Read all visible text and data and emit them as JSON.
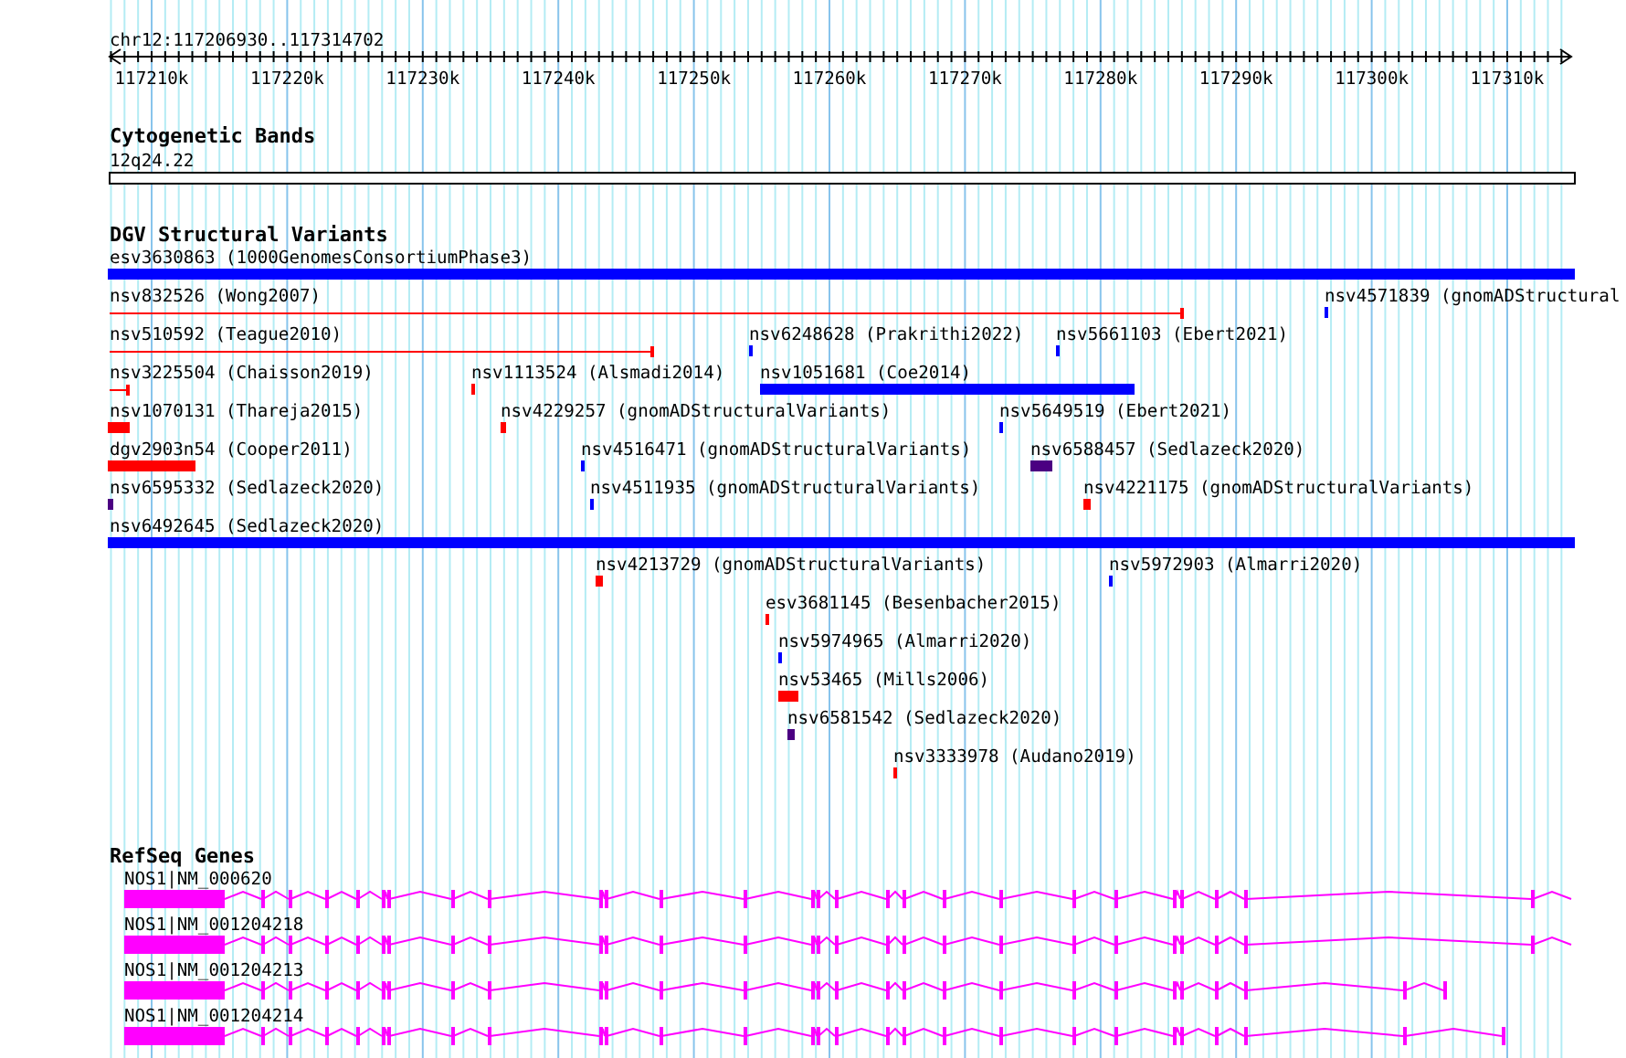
{
  "ruler": {
    "location": "chr12:117206930..117314702",
    "ticks": [
      "117210k",
      "117220k",
      "117230k",
      "117240k",
      "117250k",
      "117260k",
      "117270k",
      "117280k",
      "117290k",
      "117300k",
      "117310k"
    ]
  },
  "cytobands": {
    "title": "Cytogenetic Bands",
    "band": "12q24.22"
  },
  "variants": {
    "title": "DGV Structural Variants",
    "features": [
      {
        "label": "esv3630863 (1000GenomesConsortiumPhase3)",
        "color": "#0000ff",
        "kind": "block"
      },
      {
        "label": "nsv832526 (Wong2007)",
        "color": "#ff0000",
        "kind": "line"
      },
      {
        "label": "nsv4571839 (gnomADStructural",
        "color": "#0000ff",
        "kind": "block"
      },
      {
        "label": "nsv510592 (Teague2010)",
        "color": "#ff0000",
        "kind": "line"
      },
      {
        "label": "nsv6248628 (Prakrithi2022)",
        "color": "#0000ff",
        "kind": "block"
      },
      {
        "label": "nsv5661103 (Ebert2021)",
        "color": "#0000ff",
        "kind": "block"
      },
      {
        "label": "nsv3225504 (Chaisson2019)",
        "color": "#ff0000",
        "kind": "line"
      },
      {
        "label": "nsv1113524 (Alsmadi2014)",
        "color": "#ff0000",
        "kind": "block"
      },
      {
        "label": "nsv1051681 (Coe2014)",
        "color": "#0000ff",
        "kind": "block"
      },
      {
        "label": "nsv1070131 (Thareja2015)",
        "color": "#ff0000",
        "kind": "block"
      },
      {
        "label": "nsv4229257 (gnomADStructuralVariants)",
        "color": "#ff0000",
        "kind": "block"
      },
      {
        "label": "nsv5649519 (Ebert2021)",
        "color": "#0000ff",
        "kind": "block"
      },
      {
        "label": "dgv2903n54 (Cooper2011)",
        "color": "#ff0000",
        "kind": "block"
      },
      {
        "label": "nsv4516471 (gnomADStructuralVariants)",
        "color": "#0000ff",
        "kind": "block"
      },
      {
        "label": "nsv6588457 (Sedlazeck2020)",
        "color": "#4b0082",
        "kind": "block"
      },
      {
        "label": "nsv6595332 (Sedlazeck2020)",
        "color": "#4b0082",
        "kind": "block"
      },
      {
        "label": "nsv4511935 (gnomADStructuralVariants)",
        "color": "#0000ff",
        "kind": "block"
      },
      {
        "label": "nsv4221175 (gnomADStructuralVariants)",
        "color": "#ff0000",
        "kind": "block"
      },
      {
        "label": "nsv6492645 (Sedlazeck2020)",
        "color": "#0000ff",
        "kind": "block"
      },
      {
        "label": "nsv4213729 (gnomADStructuralVariants)",
        "color": "#ff0000",
        "kind": "block"
      },
      {
        "label": "nsv5972903 (Almarri2020)",
        "color": "#0000ff",
        "kind": "block"
      },
      {
        "label": "esv3681145 (Besenbacher2015)",
        "color": "#ff0000",
        "kind": "block"
      },
      {
        "label": "nsv5974965 (Almarri2020)",
        "color": "#0000ff",
        "kind": "block"
      },
      {
        "label": "nsv53465 (Mills2006)",
        "color": "#ff0000",
        "kind": "block"
      },
      {
        "label": "nsv6581542 (Sedlazeck2020)",
        "color": "#4b0082",
        "kind": "block"
      },
      {
        "label": "nsv3333978 (Audano2019)",
        "color": "#ff0000",
        "kind": "block"
      }
    ]
  },
  "genes": {
    "title": "RefSeq Genes",
    "transcripts": [
      {
        "label": "NOS1|NM_000620"
      },
      {
        "label": "NOS1|NM_001204218"
      },
      {
        "label": "NOS1|NM_001204213"
      },
      {
        "label": "NOS1|NM_001204214"
      }
    ]
  }
}
